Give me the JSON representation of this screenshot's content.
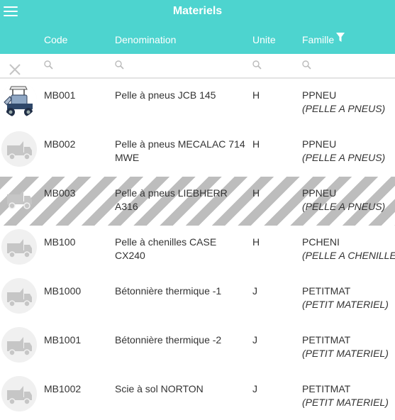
{
  "header": {
    "title": "Materiels",
    "columns": {
      "code": "Code",
      "denomination": "Denomination",
      "unite": "Unite",
      "famille": "Famille"
    }
  },
  "rows": [
    {
      "code": "MB001",
      "denomination": "Pelle à pneus JCB 145",
      "unite": "H",
      "famille_code": "PPNEU",
      "famille_label": "(PELLE A PNEUS)",
      "thumbnail": "machine-photo",
      "striped": false
    },
    {
      "code": "MB002",
      "denomination": "Pelle à pneus MECALAC 714 MWE",
      "unite": "H",
      "famille_code": "PPNEU",
      "famille_label": "(PELLE A PNEUS)",
      "thumbnail": "truck-placeholder-icon",
      "striped": false
    },
    {
      "code": "MB003",
      "denomination": "Pelle à pneus LIEBHERR A316",
      "unite": "H",
      "famille_code": "PPNEU",
      "famille_label": "(PELLE A PNEUS)",
      "thumbnail": "truck-placeholder-icon",
      "striped": true
    },
    {
      "code": "MB100",
      "denomination": "Pelle à chenilles CASE CX240",
      "unite": "H",
      "famille_code": "PCHENI",
      "famille_label": "(PELLE A CHENILLES)",
      "thumbnail": "truck-placeholder-icon",
      "striped": false
    },
    {
      "code": "MB1000",
      "denomination": "Bétonnière thermique -1",
      "unite": "J",
      "famille_code": "PETITMAT",
      "famille_label": "(PETIT MATERIEL)",
      "thumbnail": "truck-placeholder-icon",
      "striped": false
    },
    {
      "code": "MB1001",
      "denomination": "Bétonnière thermique -2",
      "unite": "J",
      "famille_code": "PETITMAT",
      "famille_label": "(PETIT MATERIEL)",
      "thumbnail": "truck-placeholder-icon",
      "striped": false
    },
    {
      "code": "MB1002",
      "denomination": "Scie à sol NORTON",
      "unite": "J",
      "famille_code": "PETITMAT",
      "famille_label": "(PETIT MATERIEL)",
      "thumbnail": "truck-placeholder-icon",
      "striped": false
    }
  ],
  "colors": {
    "header_bg": "#4dd4cf",
    "header_text": "#ffffff",
    "stripe": "#bdbdbd"
  }
}
